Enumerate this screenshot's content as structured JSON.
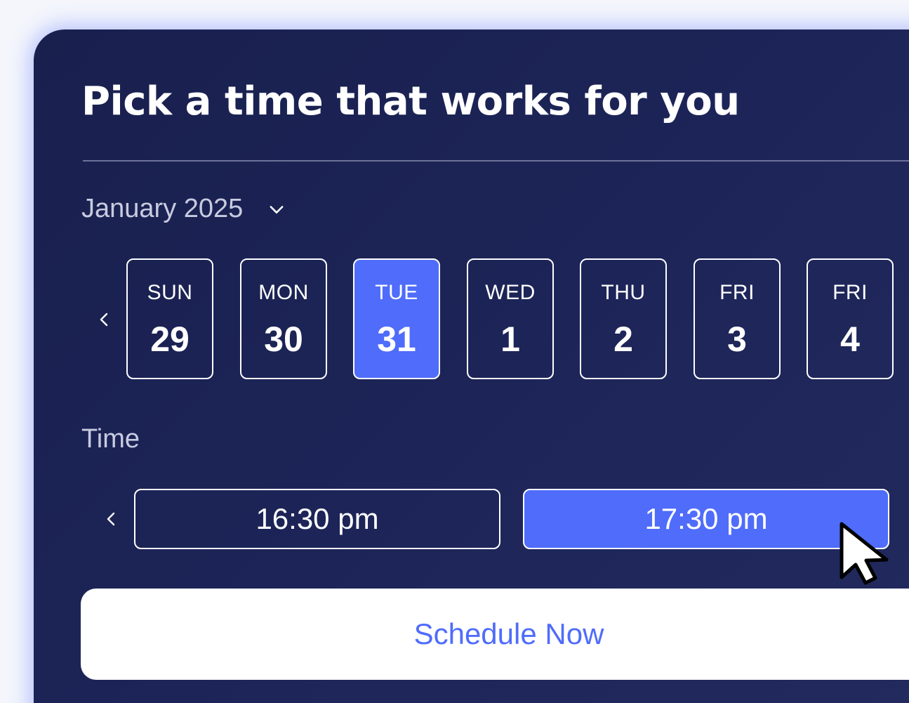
{
  "header": {
    "title": "Pick a time that works for you"
  },
  "calendar": {
    "month_label": "January 2025",
    "days": [
      {
        "name": "SUN",
        "number": "29",
        "selected": false
      },
      {
        "name": "MON",
        "number": "30",
        "selected": false
      },
      {
        "name": "TUE",
        "number": "31",
        "selected": true
      },
      {
        "name": "WED",
        "number": "1",
        "selected": false
      },
      {
        "name": "THU",
        "number": "2",
        "selected": false
      },
      {
        "name": "FRI",
        "number": "3",
        "selected": false
      },
      {
        "name": "FRI",
        "number": "4",
        "selected": false
      }
    ]
  },
  "time": {
    "heading": "Time",
    "slots": [
      {
        "label": "16:30 pm",
        "selected": false
      },
      {
        "label": "17:30 pm",
        "selected": true
      }
    ]
  },
  "actions": {
    "schedule_label": "Schedule Now"
  },
  "icons": {
    "month_dropdown": "chevron-down-icon",
    "day_prev": "chevron-left-icon",
    "time_prev": "chevron-left-icon",
    "time_next": "chevron-right-icon",
    "pointer": "mouse-pointer-icon"
  },
  "colors": {
    "background": "#1d2559",
    "accent": "#4f6cfb",
    "text_primary": "#ffffff",
    "text_secondary": "#c8cbe0",
    "button_bg": "#ffffff"
  }
}
